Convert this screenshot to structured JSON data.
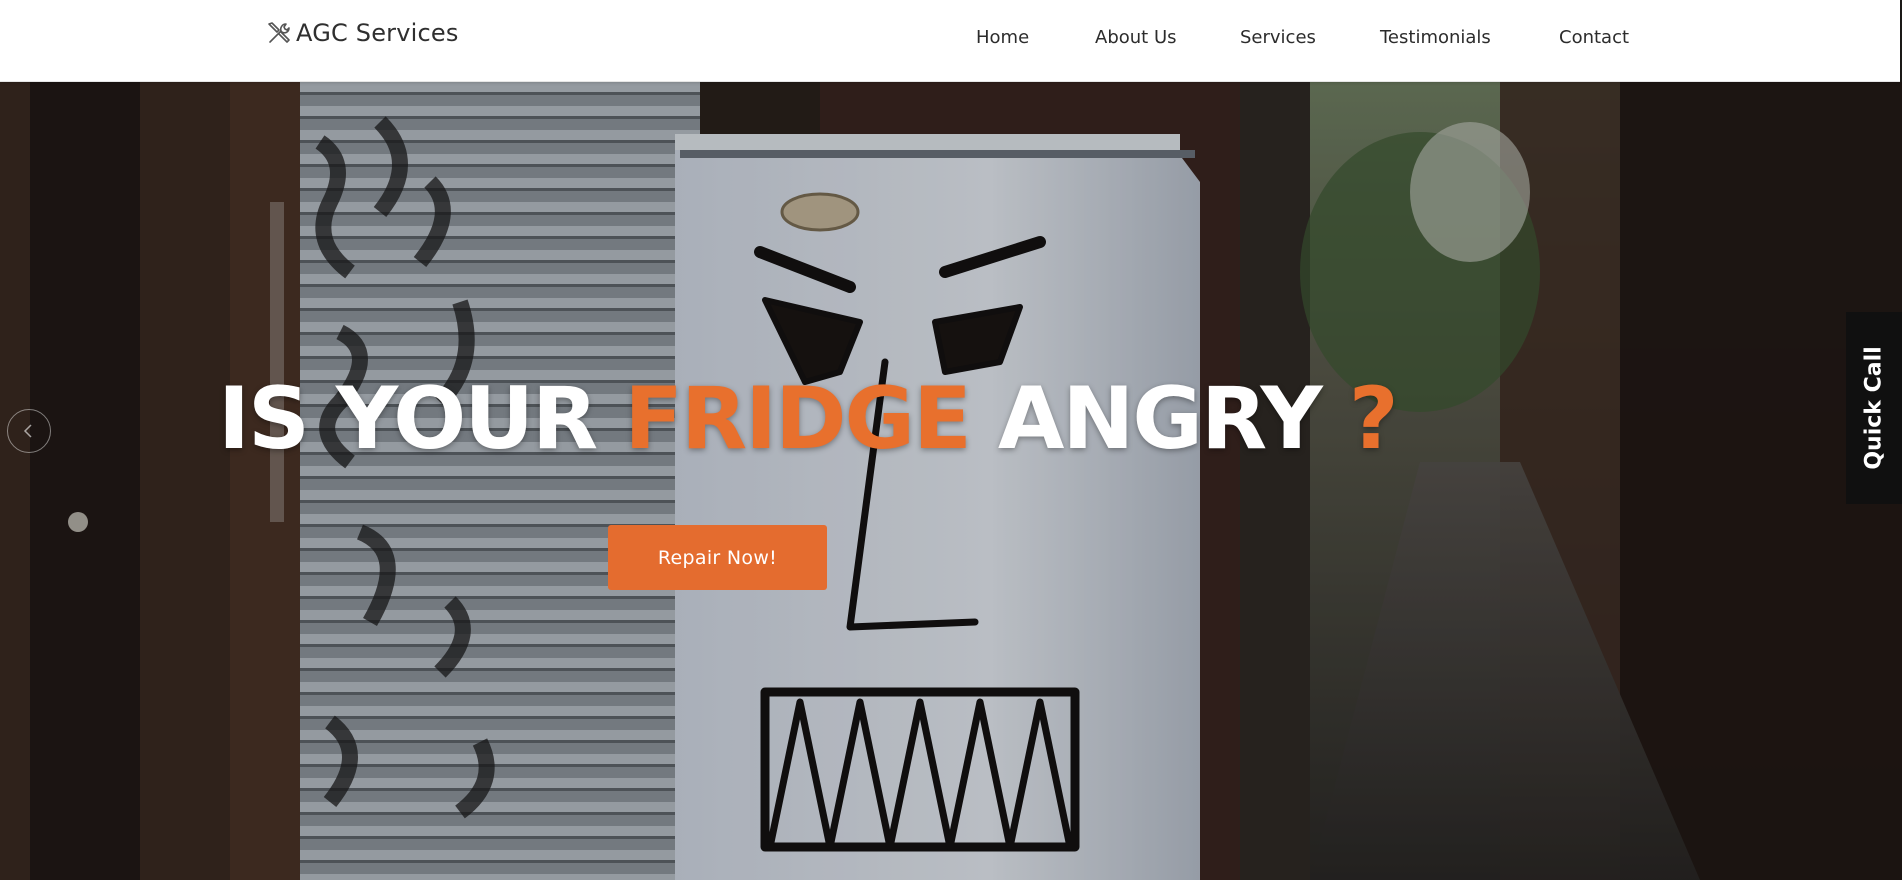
{
  "brand": {
    "name": "AGC Services",
    "icon": "tools-icon"
  },
  "nav": {
    "items": [
      {
        "label": "Home"
      },
      {
        "label": "About Us"
      },
      {
        "label": "Services"
      },
      {
        "label": "Testimonials"
      },
      {
        "label": "Contact"
      }
    ]
  },
  "hero": {
    "title_part1": "IS YOUR ",
    "title_accent": "FRIDGE",
    "title_part2": " ANGRY ",
    "title_question": "?",
    "cta_label": "Repair Now!",
    "prev_icon": "chevron-left-icon"
  },
  "quick_call": {
    "label": "Quick Call"
  },
  "colors": {
    "accent": "#e46c2f",
    "header_bg": "#ffffff",
    "nav_text": "#2c2c2c",
    "hero_text": "#ffffff"
  }
}
